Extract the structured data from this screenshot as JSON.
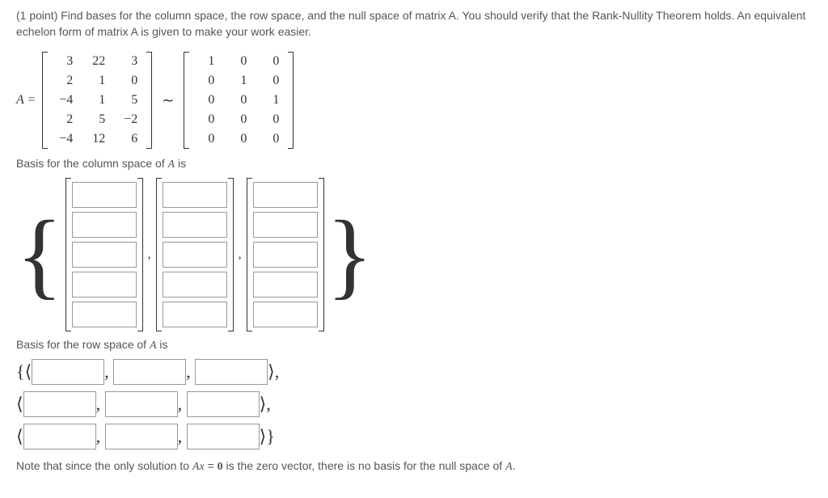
{
  "problem": {
    "points": "(1 point)",
    "text": "Find bases for the column space, the row space, and the null space of matrix A. You should verify that the Rank-Nullity Theorem holds. An equivalent echelon form of matrix A is given to make your work easier."
  },
  "matrix_label": "A =",
  "matrix_A": [
    [
      "3",
      "22",
      "3"
    ],
    [
      "2",
      "1",
      "0"
    ],
    [
      "−4",
      "1",
      "5"
    ],
    [
      "2",
      "5",
      "−2"
    ],
    [
      "−4",
      "12",
      "6"
    ]
  ],
  "tilde": "∼",
  "matrix_echelon": [
    [
      "1",
      "0",
      "0"
    ],
    [
      "0",
      "1",
      "0"
    ],
    [
      "0",
      "0",
      "1"
    ],
    [
      "0",
      "0",
      "0"
    ],
    [
      "0",
      "0",
      "0"
    ]
  ],
  "labels": {
    "col_space": "Basis for the column space of ",
    "col_space_suffix": " is",
    "row_space": "Basis for the row space of ",
    "row_space_suffix": " is",
    "var_A": "A"
  },
  "braces": {
    "open": "{",
    "close": "}",
    "comma": ","
  },
  "angles": {
    "open": "⟨",
    "close": "⟩"
  },
  "note": {
    "prefix": "Note that since the only solution to ",
    "eq_left": "Ax",
    "eq_mid": " = ",
    "eq_right": "0",
    "suffix": " is the zero vector, there is no basis for the null space of ",
    "end": "."
  }
}
